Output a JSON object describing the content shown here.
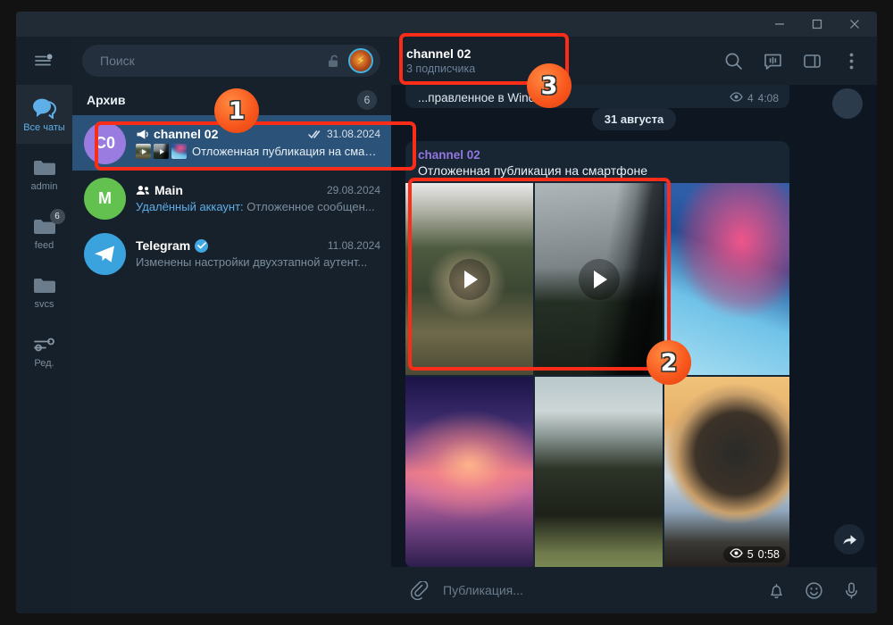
{
  "window": {
    "minimize_label": "Свернуть",
    "maximize_label": "Развернуть",
    "close_label": "Закрыть"
  },
  "rail": {
    "menu_icon": "hamburger-menu-icon",
    "items": [
      {
        "label": "Все чаты",
        "icon": "chats-icon",
        "badge": "",
        "active": true
      },
      {
        "label": "admin",
        "icon": "folder-icon",
        "badge": "",
        "active": false
      },
      {
        "label": "feed",
        "icon": "folder-icon",
        "badge": "6",
        "active": false
      },
      {
        "label": "svcs",
        "icon": "folder-icon",
        "badge": "",
        "active": false
      },
      {
        "label": "Ред.",
        "icon": "sliders-icon",
        "badge": "",
        "active": false
      }
    ]
  },
  "search": {
    "placeholder": "Поиск",
    "lock_icon": "unlocked-padlock-icon",
    "avatar_icon": "lightning-bolt-avatar"
  },
  "archive": {
    "label": "Архив",
    "count": "6"
  },
  "chats": [
    {
      "name": "channel 02",
      "avatar_text": "C0",
      "avatar_color": "#9a7ce0",
      "date": "31.08.2024",
      "name_icon": "megaphone-icon",
      "status_icon": "double-check-icon",
      "preview": "Отложенная публикация на смар...",
      "preview_sender": "",
      "selected": true,
      "thumbs": [
        "video-thumb-deer",
        "video-thumb-train",
        "photo-thumb-sakura"
      ]
    },
    {
      "name": "Main",
      "avatar_text": "M",
      "avatar_color": "#62c14f",
      "date": "29.08.2024",
      "name_icon": "group-icon",
      "status_icon": "",
      "preview": "Отложенное сообщен...",
      "preview_sender": "Удалённый аккаунт:",
      "selected": false,
      "thumbs": []
    },
    {
      "name": "Telegram",
      "avatar_text": "",
      "avatar_color": "#3aa3dd",
      "date": "11.08.2024",
      "name_icon": "verified-badge-icon",
      "status_icon": "",
      "preview": "Изменены настройки двухэтапной аутент...",
      "preview_sender": "",
      "selected": false,
      "thumbs": []
    }
  ],
  "chat_header": {
    "title": "channel 02",
    "subtitle": "3 подписчика",
    "buttons": [
      {
        "name": "search-icon",
        "label": "Поиск"
      },
      {
        "name": "live-stream-icon",
        "label": "Трансляция"
      },
      {
        "name": "sidebar-toggle-icon",
        "label": "Информация"
      },
      {
        "name": "more-options-icon",
        "label": "Ещё"
      }
    ]
  },
  "conversation": {
    "previous_message": {
      "text": "...правленное в Windows",
      "views": "4",
      "time": "4:08"
    },
    "date_separator": "31 августа",
    "message": {
      "channel": "channel 02",
      "text": "Отложенная публикация на смартфоне",
      "views": "5",
      "time": "0:58",
      "forward_icon": "forward-arrow-icon",
      "media": [
        {
          "name": "photo-deer",
          "kind": "video",
          "art": "ph-deer"
        },
        {
          "name": "photo-train",
          "kind": "video",
          "art": "ph-train"
        },
        {
          "name": "photo-sakura",
          "kind": "photo",
          "art": "ph-sakura"
        },
        {
          "name": "photo-balloons",
          "kind": "photo",
          "art": "ph-balloons"
        },
        {
          "name": "photo-mountain",
          "kind": "photo",
          "art": "ph-mountain"
        },
        {
          "name": "photo-globe",
          "kind": "photo",
          "art": "ph-globe"
        }
      ]
    }
  },
  "composer": {
    "attach_icon": "paperclip-icon",
    "placeholder": "Публикация...",
    "mute_icon": "bell-icon",
    "emoji_icon": "smiley-icon",
    "voice_icon": "microphone-icon"
  },
  "annotations": [
    {
      "number": "1",
      "target": "chat-list-selected-row"
    },
    {
      "number": "2",
      "target": "media-grid-videos"
    },
    {
      "number": "3",
      "target": "chat-header-title"
    }
  ],
  "colors": {
    "accent": "#2b5278",
    "annotation": "#fc2d18",
    "link": "#5eaee8",
    "channel_name": "#9277e0"
  }
}
